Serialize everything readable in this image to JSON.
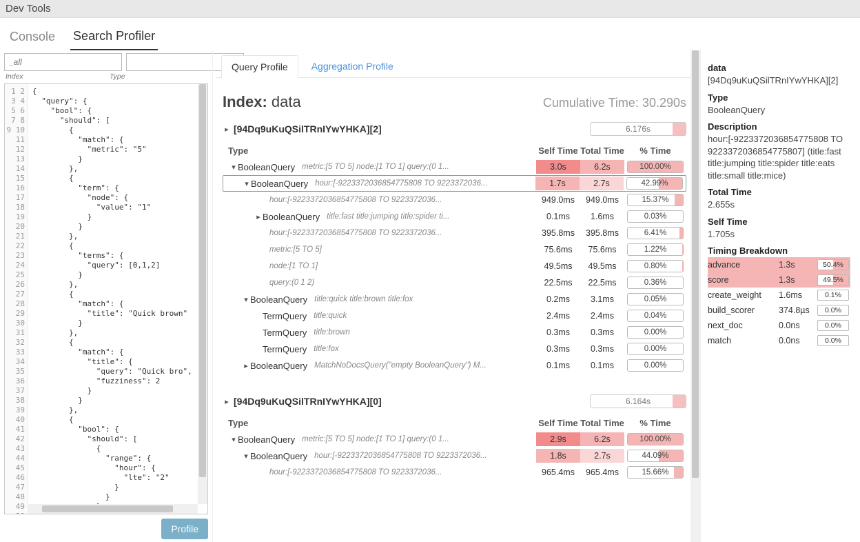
{
  "app_title": "Dev Tools",
  "top_tabs": {
    "console": "Console",
    "search_profiler": "Search Profiler"
  },
  "inputs": {
    "index_placeholder": "_all",
    "index_label": "Index",
    "type_placeholder": "",
    "type_label": "Type",
    "profile_button": "Profile"
  },
  "editor": {
    "lines": 50,
    "code": "{\n  \"query\": {\n    \"bool\": {\n      \"should\": [\n        {\n          \"match\": {\n            \"metric\": \"5\"\n          }\n        },\n        {\n          \"term\": {\n            \"node\": {\n              \"value\": \"1\"\n            }\n          }\n        },\n        {\n          \"terms\": {\n            \"query\": [0,1,2]\n          }\n        },\n        {\n          \"match\": {\n            \"title\": \"Quick brown\"\n          }\n        },\n        {\n          \"match\": {\n            \"title\": {\n              \"query\": \"Quick bro\",\n              \"fuzziness\": 2\n            }\n          }\n        },\n        {\n          \"bool\": {\n            \"should\": [\n              {\n                \"range\": {\n                  \"hour\": {\n                    \"lte\": \"2\"\n                  }\n                }\n              },\n              {\n                \"match\": {\n                  \"title\": \"Fas\"\n                }\n              }"
  },
  "sub_tabs": {
    "query": "Query Profile",
    "agg": "Aggregation Profile"
  },
  "profile": {
    "index_label": "Index:",
    "index_name": "data",
    "cum_label": "Cumulative Time:",
    "cum_value": "30.290s",
    "headers": {
      "type": "Type",
      "self": "Self Time",
      "total": "Total Time",
      "pct": "% Time"
    }
  },
  "shard1": {
    "title": "[94Dq9uKuQSilTRnIYwYHKA][2]",
    "bar_time": "6.176s",
    "bar_fill_pct": 14,
    "rows": [
      {
        "indent": 1,
        "chev": "v",
        "name": "BooleanQuery",
        "desc": "metric:[5 TO 5] node:[1 TO 1] query:(0 1...",
        "self": "3.0s",
        "total": "6.2s",
        "pct": "100.00%",
        "fill": 100,
        "sbg": "bg-red1",
        "tbg": "bg-red2"
      },
      {
        "indent": 2,
        "chev": "v",
        "name": "BooleanQuery",
        "desc": "hour:[-9223372036854775808 TO 9223372036...",
        "self": "1.7s",
        "total": "2.7s",
        "pct": "42.99%",
        "fill": 43,
        "sbg": "bg-red2",
        "tbg": "bg-red3",
        "selected": true
      },
      {
        "indent": 3,
        "chev": "",
        "name": "",
        "desc": "hour:[-9223372036854775808 TO 9223372036...",
        "self": "949.0ms",
        "total": "949.0ms",
        "pct": "15.37%",
        "fill": 15
      },
      {
        "indent": 3,
        "chev": ">",
        "name": "BooleanQuery",
        "desc": "title:fast title:jumping title:spider ti...",
        "self": "0.1ms",
        "total": "1.6ms",
        "pct": "0.03%",
        "fill": 0
      },
      {
        "indent": 3,
        "chev": "",
        "name": "",
        "desc": "hour:[-9223372036854775808 TO 9223372036...",
        "self": "395.8ms",
        "total": "395.8ms",
        "pct": "6.41%",
        "fill": 6
      },
      {
        "indent": 3,
        "chev": "",
        "name": "",
        "desc": "metric:[5 TO 5]",
        "self": "75.6ms",
        "total": "75.6ms",
        "pct": "1.22%",
        "fill": 1
      },
      {
        "indent": 3,
        "chev": "",
        "name": "",
        "desc": "node:[1 TO 1]",
        "self": "49.5ms",
        "total": "49.5ms",
        "pct": "0.80%",
        "fill": 1
      },
      {
        "indent": 3,
        "chev": "",
        "name": "",
        "desc": "query:(0 1 2)",
        "self": "22.5ms",
        "total": "22.5ms",
        "pct": "0.36%",
        "fill": 0
      },
      {
        "indent": 2,
        "chev": "v",
        "name": "BooleanQuery",
        "desc": "title:quick title:brown title:fox",
        "self": "0.2ms",
        "total": "3.1ms",
        "pct": "0.05%",
        "fill": 0
      },
      {
        "indent": 3,
        "chev": "",
        "name": "TermQuery",
        "desc": "title:quick",
        "self": "2.4ms",
        "total": "2.4ms",
        "pct": "0.04%",
        "fill": 0
      },
      {
        "indent": 3,
        "chev": "",
        "name": "TermQuery",
        "desc": "title:brown",
        "self": "0.3ms",
        "total": "0.3ms",
        "pct": "0.00%",
        "fill": 0
      },
      {
        "indent": 3,
        "chev": "",
        "name": "TermQuery",
        "desc": "title:fox",
        "self": "0.3ms",
        "total": "0.3ms",
        "pct": "0.00%",
        "fill": 0
      },
      {
        "indent": 2,
        "chev": ">",
        "name": "BooleanQuery",
        "desc": "MatchNoDocsQuery(\"empty BooleanQuery\") M...",
        "self": "0.1ms",
        "total": "0.1ms",
        "pct": "0.00%",
        "fill": 0
      }
    ]
  },
  "shard2": {
    "title": "[94Dq9uKuQSilTRnIYwYHKA][0]",
    "bar_time": "6.164s",
    "bar_fill_pct": 14,
    "rows": [
      {
        "indent": 1,
        "chev": "v",
        "name": "BooleanQuery",
        "desc": "metric:[5 TO 5] node:[1 TO 1] query:(0 1...",
        "self": "2.9s",
        "total": "6.2s",
        "pct": "100.00%",
        "fill": 100,
        "sbg": "bg-red1",
        "tbg": "bg-red2"
      },
      {
        "indent": 2,
        "chev": "v",
        "name": "BooleanQuery",
        "desc": "hour:[-9223372036854775808 TO 9223372036...",
        "self": "1.8s",
        "total": "2.7s",
        "pct": "44.09%",
        "fill": 44,
        "sbg": "bg-red2",
        "tbg": "bg-red3"
      },
      {
        "indent": 3,
        "chev": "",
        "name": "",
        "desc": "hour:[-9223372036854775808 TO 9223372036...",
        "self": "965.4ms",
        "total": "965.4ms",
        "pct": "15.66%",
        "fill": 16
      }
    ]
  },
  "detail": {
    "title_label": "data",
    "title_value": "[94Dq9uKuQSilTRnIYwYHKA][2]",
    "type_label": "Type",
    "type_value": "BooleanQuery",
    "desc_label": "Description",
    "desc_value": "hour:[-9223372036854775808 TO 9223372036854775807] (title:fast title:jumping title:spider title:eats title:small title:mice)",
    "total_label": "Total Time",
    "total_value": "2.655s",
    "self_label": "Self Time",
    "self_value": "1.705s",
    "breakdown_label": "Timing Breakdown",
    "breakdown": [
      {
        "name": "advance",
        "time": "1.3s",
        "pct": "50.4%",
        "fill": 50,
        "hl": true
      },
      {
        "name": "score",
        "time": "1.3s",
        "pct": "49.5%",
        "fill": 50,
        "hl": true
      },
      {
        "name": "create_weight",
        "time": "1.6ms",
        "pct": "0.1%",
        "fill": 0
      },
      {
        "name": "build_scorer",
        "time": "374.8µs",
        "pct": "0.0%",
        "fill": 0
      },
      {
        "name": "next_doc",
        "time": "0.0ns",
        "pct": "0.0%",
        "fill": 0
      },
      {
        "name": "match",
        "time": "0.0ns",
        "pct": "0.0%",
        "fill": 0
      }
    ]
  }
}
